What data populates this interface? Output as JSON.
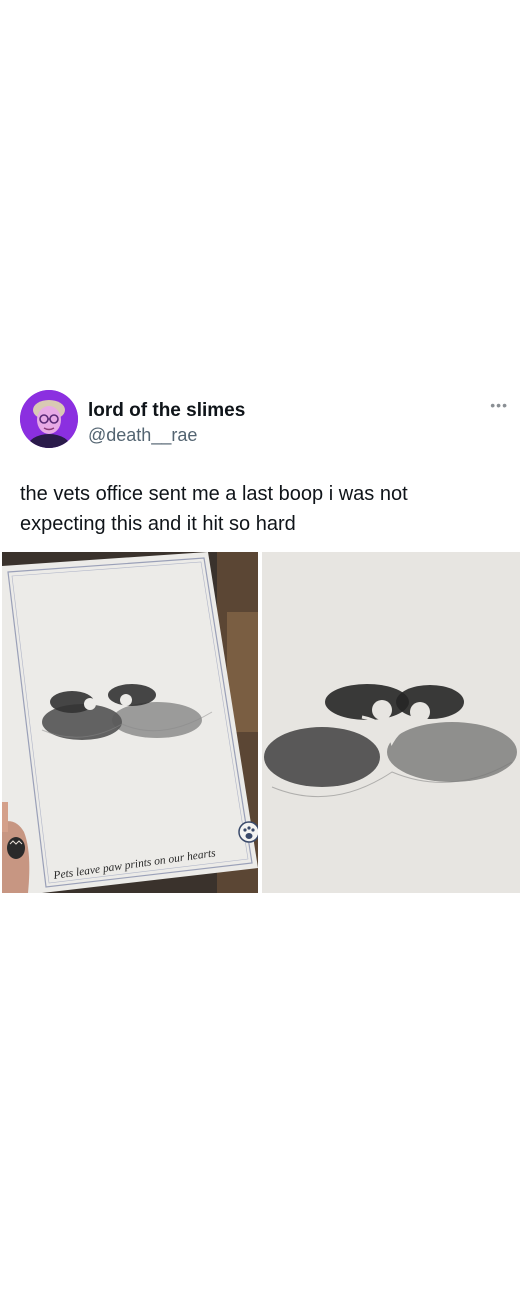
{
  "tweet": {
    "display_name": "lord of the slimes",
    "handle": "@death__rae",
    "more_icon": "more-horizontal-icon",
    "text": "the vets office sent me a last boop i was not expecting this and it hit so hard",
    "media": [
      {
        "kind": "photo",
        "caption_on_card": "Pets leave paw prints on our hearts",
        "icon": "paw-logo-icon"
      },
      {
        "kind": "photo"
      }
    ]
  },
  "colors": {
    "text": "#0f1419",
    "secondary": "#536471",
    "avatar_bg": "#8a2be2"
  }
}
